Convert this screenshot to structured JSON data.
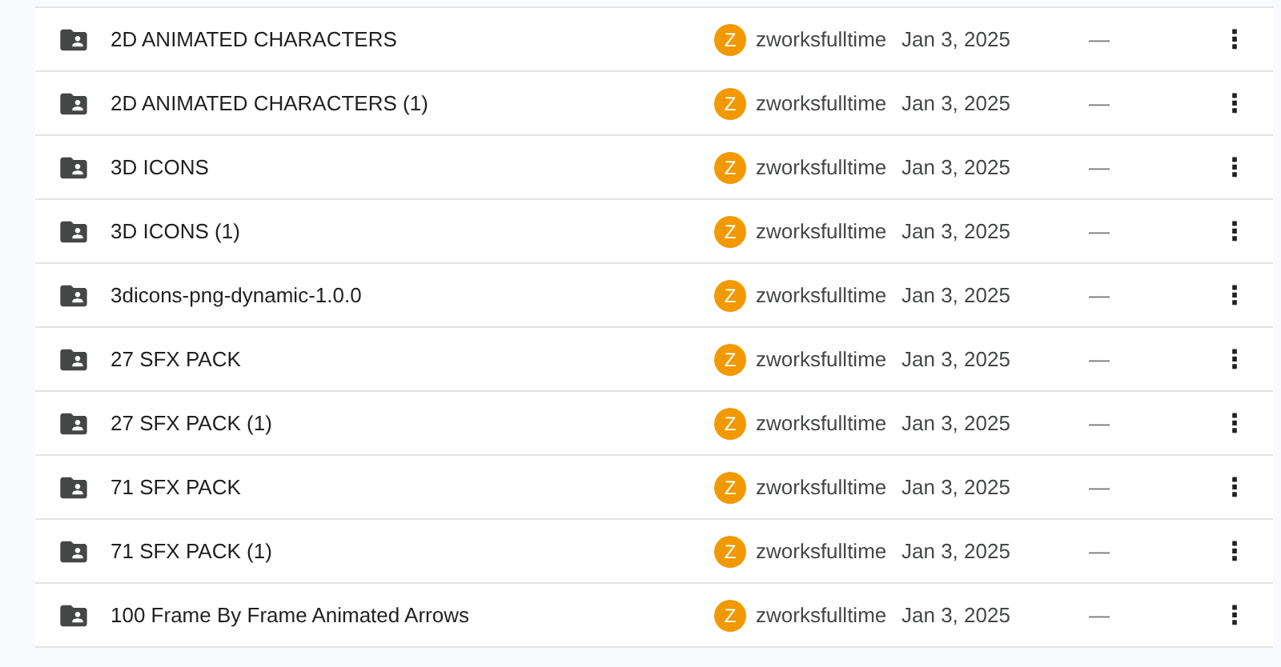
{
  "files": [
    {
      "name": "2D ANIMATED CHARACTERS",
      "owner_initial": "Z",
      "owner": "zworksfulltime",
      "modified": "Jan 3, 2025",
      "size": "—",
      "menu": "⋮"
    },
    {
      "name": "2D ANIMATED CHARACTERS (1)",
      "owner_initial": "Z",
      "owner": "zworksfulltime",
      "modified": "Jan 3, 2025",
      "size": "—",
      "menu": "⋮"
    },
    {
      "name": "3D ICONS",
      "owner_initial": "Z",
      "owner": "zworksfulltime",
      "modified": "Jan 3, 2025",
      "size": "—",
      "menu": "⋮"
    },
    {
      "name": "3D ICONS (1)",
      "owner_initial": "Z",
      "owner": "zworksfulltime",
      "modified": "Jan 3, 2025",
      "size": "—",
      "menu": "⋮"
    },
    {
      "name": "3dicons-png-dynamic-1.0.0",
      "owner_initial": "Z",
      "owner": "zworksfulltime",
      "modified": "Jan 3, 2025",
      "size": "—",
      "menu": "⋮"
    },
    {
      "name": "27 SFX PACK",
      "owner_initial": "Z",
      "owner": "zworksfulltime",
      "modified": "Jan 3, 2025",
      "size": "—",
      "menu": "⋮"
    },
    {
      "name": "27 SFX PACK (1)",
      "owner_initial": "Z",
      "owner": "zworksfulltime",
      "modified": "Jan 3, 2025",
      "size": "—",
      "menu": "⋮"
    },
    {
      "name": "71 SFX PACK",
      "owner_initial": "Z",
      "owner": "zworksfulltime",
      "modified": "Jan 3, 2025",
      "size": "—",
      "menu": "⋮"
    },
    {
      "name": "71 SFX PACK (1)",
      "owner_initial": "Z",
      "owner": "zworksfulltime",
      "modified": "Jan 3, 2025",
      "size": "—",
      "menu": "⋮"
    },
    {
      "name": "100 Frame By Frame Animated Arrows",
      "owner_initial": "Z",
      "owner": "zworksfulltime",
      "modified": "Jan 3, 2025",
      "size": "—",
      "menu": "⋮"
    }
  ]
}
